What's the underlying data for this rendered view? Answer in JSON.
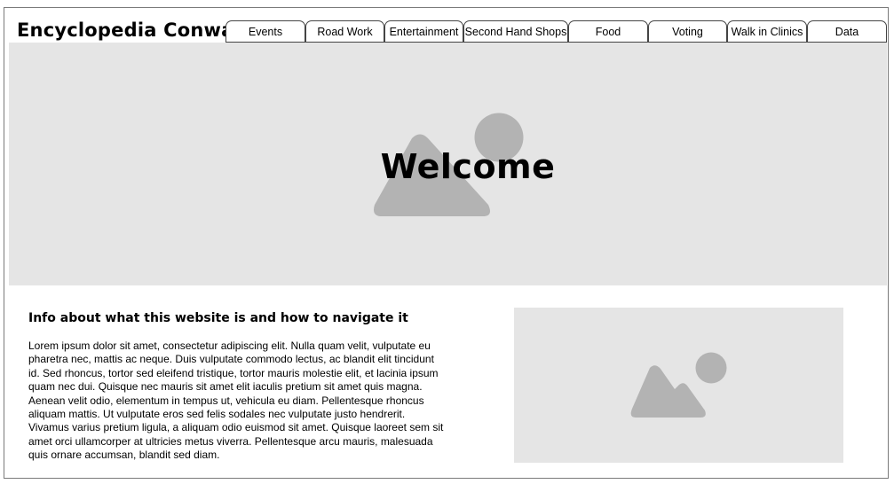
{
  "header": {
    "site_title": "Encyclopedia Conway",
    "tabs": [
      {
        "label": "Events"
      },
      {
        "label": "Road Work"
      },
      {
        "label": "Entertainment"
      },
      {
        "label": "Second Hand Shops"
      },
      {
        "label": "Food"
      },
      {
        "label": "Voting"
      },
      {
        "label": "Walk in Clinics"
      },
      {
        "label": "Data"
      }
    ]
  },
  "hero": {
    "title": "Welcome",
    "background_color": "#e5e5e5",
    "placeholder_icon": "image-placeholder-icon",
    "icon_color": "#b3b3b3"
  },
  "info": {
    "heading": "Info about what this website is and how to navigate it",
    "body": "Lorem ipsum dolor sit amet, consectetur adipiscing elit. Nulla quam velit, vulputate eu pharetra nec, mattis ac neque. Duis vulputate commodo lectus, ac blandit elit tincidunt id. Sed rhoncus, tortor sed eleifend tristique, tortor mauris molestie elit, et lacinia ipsum quam nec dui. Quisque nec mauris sit amet elit iaculis pretium sit amet quis magna. Aenean velit odio, elementum in tempus ut, vehicula eu diam. Pellentesque rhoncus aliquam mattis. Ut vulputate eros sed felis sodales nec vulputate justo hendrerit. Vivamus varius pretium ligula, a aliquam odio euismod sit amet. Quisque laoreet sem sit amet orci ullamcorper at ultricies metus viverra. Pellentesque arcu mauris, malesuada quis ornare accumsan, blandit sed diam."
  },
  "side_image": {
    "placeholder_icon": "image-placeholder-icon",
    "background_color": "#e5e5e5"
  }
}
